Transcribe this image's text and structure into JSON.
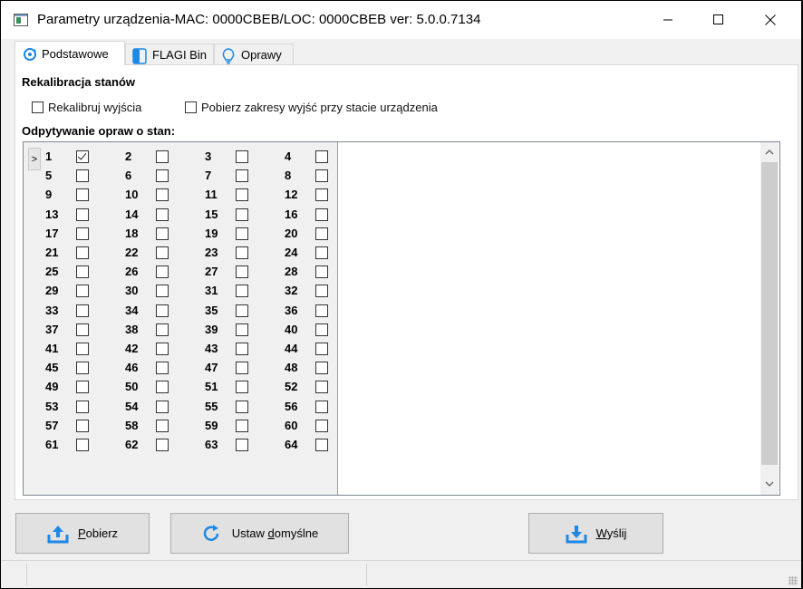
{
  "window": {
    "title": "Parametry urządzenia-MAC: 0000CBEB/LOC: 0000CBEB ver: 5.0.0.7134"
  },
  "tabs": [
    {
      "label": "Podstawowe",
      "icon": "settings-refresh-icon",
      "active": true
    },
    {
      "label": "FLAGI Bin",
      "icon": "toggle-icon",
      "active": false
    },
    {
      "label": "Oprawy",
      "icon": "lightbulb-icon",
      "active": false
    }
  ],
  "recalibration": {
    "heading": "Rekalibracja stanów",
    "recalibrate_label": "Rekalibruj wyjścia",
    "fetch_ranges_label": "Pobierz zakresy wyjść przy stacie urządzenia"
  },
  "polling": {
    "heading": "Odpytywanie opraw o stan:",
    "row_marker": ">",
    "checked": [
      1
    ]
  },
  "buttons": {
    "fetch": {
      "label": "Pobierz",
      "underline_char": "P",
      "rest": "obierz"
    },
    "defaults": {
      "label": "Ustaw domyślne",
      "before": "Ustaw ",
      "underline_char": "d",
      "rest": "omyślne"
    },
    "send": {
      "label": "Wyślij",
      "underline_char": "W",
      "rest": "yślij"
    }
  },
  "colors": {
    "accent": "#1e88e5",
    "window_bg": "#f0f0f0",
    "panel_bg": "#ffffff"
  }
}
